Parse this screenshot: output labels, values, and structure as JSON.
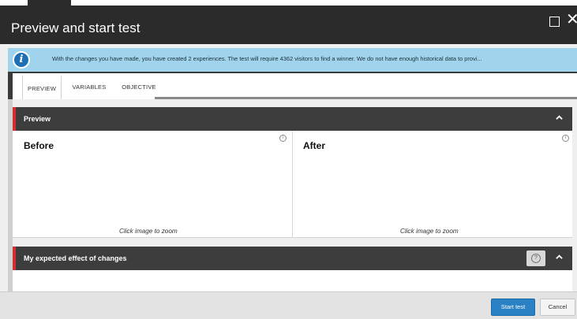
{
  "dialog": {
    "title": "Preview and start test"
  },
  "info": {
    "text": "With the changes you have made, you have created 2 experiences. The test will require 4362 visitors to find a winner. We do not have enough historical data to provi..."
  },
  "tabs": [
    {
      "label": "PREVIEW",
      "active": true
    },
    {
      "label": "VARIABLES",
      "active": false
    },
    {
      "label": "OBJECTIVE",
      "active": false
    }
  ],
  "preview": {
    "header": "Preview",
    "before": {
      "title": "Before",
      "zoom_hint": "Click image to zoom"
    },
    "after": {
      "title": "After",
      "zoom_hint": "Click image to zoom"
    }
  },
  "effect": {
    "header": "My expected effect of changes"
  },
  "footer": {
    "start_label": "Start test",
    "cancel_label": "Cancel"
  },
  "icons": {
    "info": "info-icon",
    "maximize": "maximize-icon",
    "close": "close-icon",
    "collapse": "chevron-up-icon",
    "help": "help-icon",
    "image_info": "info-circle-icon"
  },
  "colors": {
    "titlebar": "#2b2b2b",
    "info_bar": "#9fd4ec",
    "section_header": "#3d3d3d",
    "section_accent": "#d32f2f",
    "primary_button": "#2a81c4"
  }
}
